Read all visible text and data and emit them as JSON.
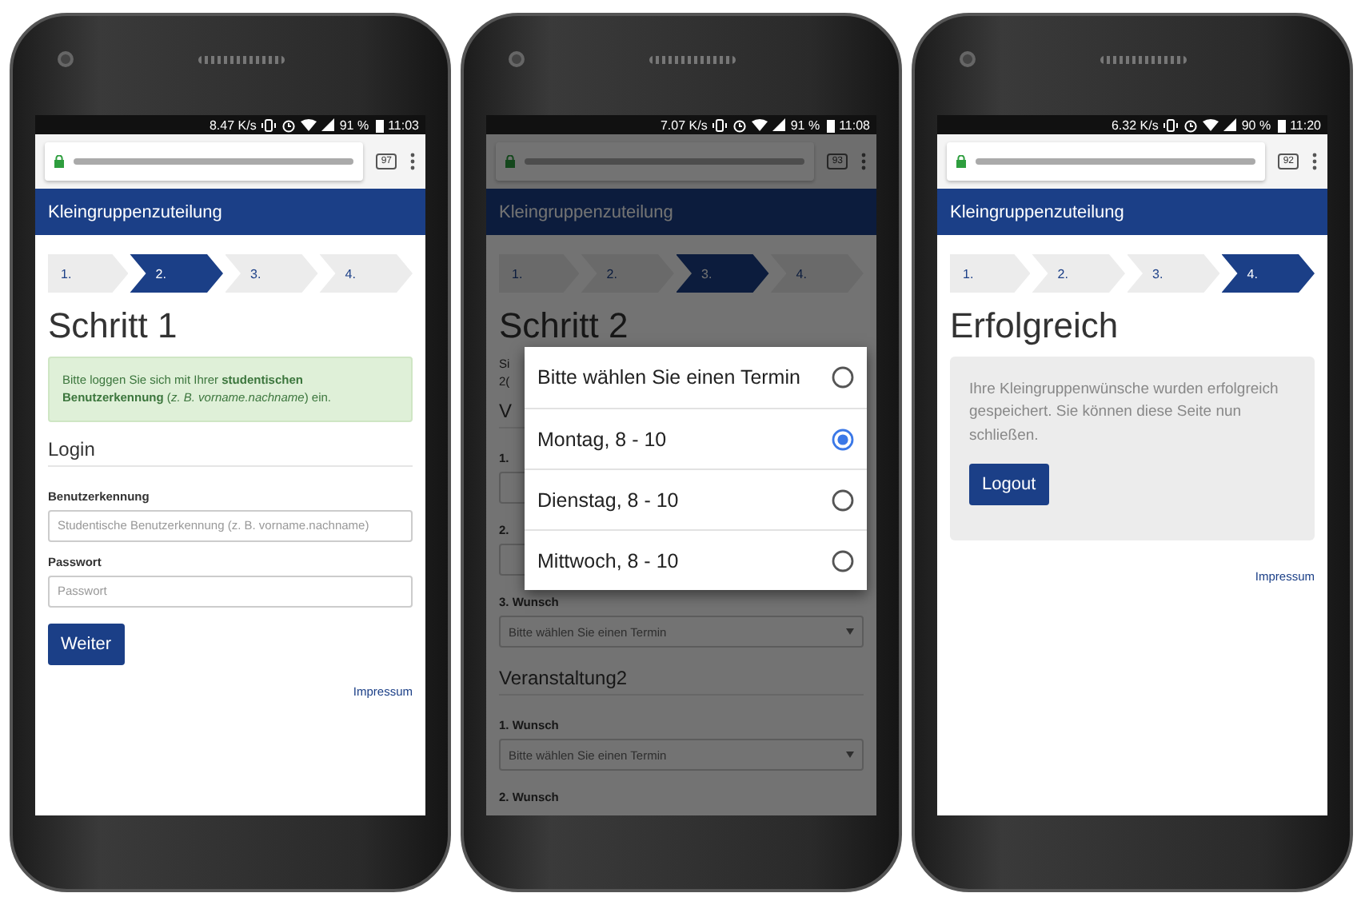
{
  "phones": [
    {
      "status": {
        "speed": "8.47 K/s",
        "battery": "91 %",
        "time": "11:03"
      },
      "browser": {
        "tab_count": "97"
      },
      "app_title": "Kleingruppenzuteilung",
      "steps": [
        {
          "label": "1.",
          "selected": false
        },
        {
          "label": "2.",
          "selected": true
        },
        {
          "label": "3.",
          "selected": false
        },
        {
          "label": "4.",
          "selected": false
        }
      ],
      "heading": "Schritt 1",
      "blocks": [
        {
          "kind": "alert",
          "text": "Bitte loggen Sie sich mit Ihrer **studentischen Benutzerkennung** (*z. B. vorname.nachname*) ein."
        },
        {
          "kind": "section",
          "text": "Login"
        },
        {
          "kind": "field",
          "label": "Benutzerkennung",
          "placeholder": "Studentische Benutzerkennung (z. B. vorname.nachname)"
        },
        {
          "kind": "field",
          "label": "Passwort",
          "placeholder": "Passwort"
        },
        {
          "kind": "button",
          "text": "Weiter"
        },
        {
          "kind": "link",
          "text": "Impressum"
        }
      ]
    },
    {
      "status": {
        "speed": "7.07 K/s",
        "battery": "91 %",
        "time": "11:08"
      },
      "browser": {
        "tab_count": "93"
      },
      "app_title": "Kleingruppenzuteilung",
      "steps": [
        {
          "label": "1.",
          "selected": false
        },
        {
          "label": "2.",
          "selected": false
        },
        {
          "label": "3.",
          "selected": true
        },
        {
          "label": "4.",
          "selected": false
        }
      ],
      "heading": "Schritt 2",
      "blocks": [
        {
          "kind": "text",
          "lines": [
            "Si",
            "2("
          ]
        },
        {
          "kind": "section",
          "text": "V"
        },
        {
          "kind": "select_field",
          "label": "1."
        },
        {
          "kind": "select_field",
          "label": "2."
        },
        {
          "kind": "select_field",
          "label": "3. Wunsch",
          "value": "Bitte wählen Sie einen Termin"
        },
        {
          "kind": "section",
          "text": "Veranstaltung2"
        },
        {
          "kind": "select_field",
          "label": "1. Wunsch",
          "value": "Bitte wählen Sie einen Termin"
        },
        {
          "kind": "label",
          "label": "2. Wunsch"
        }
      ],
      "dialog": {
        "options": [
          {
            "label": "Bitte wählen Sie einen Termin",
            "selected": false
          },
          {
            "label": "Montag, 8 - 10",
            "selected": true
          },
          {
            "label": "Dienstag, 8 - 10",
            "selected": false
          },
          {
            "label": "Mittwoch, 8 - 10",
            "selected": false
          }
        ]
      }
    },
    {
      "status": {
        "speed": "6.32 K/s",
        "battery": "90 %",
        "time": "11:20"
      },
      "browser": {
        "tab_count": "92"
      },
      "app_title": "Kleingruppenzuteilung",
      "steps": [
        {
          "label": "1.",
          "selected": false
        },
        {
          "label": "2.",
          "selected": false
        },
        {
          "label": "3.",
          "selected": false
        },
        {
          "label": "4.",
          "selected": true
        }
      ],
      "heading": "Erfolgreich",
      "blocks": [
        {
          "kind": "panel",
          "text": "Ihre Kleingruppenwünsche wurden erfolgreich gespeichert. Sie können diese Seite nun schließen.",
          "button": "Logout"
        },
        {
          "kind": "link",
          "text": "Impressum"
        }
      ]
    }
  ]
}
